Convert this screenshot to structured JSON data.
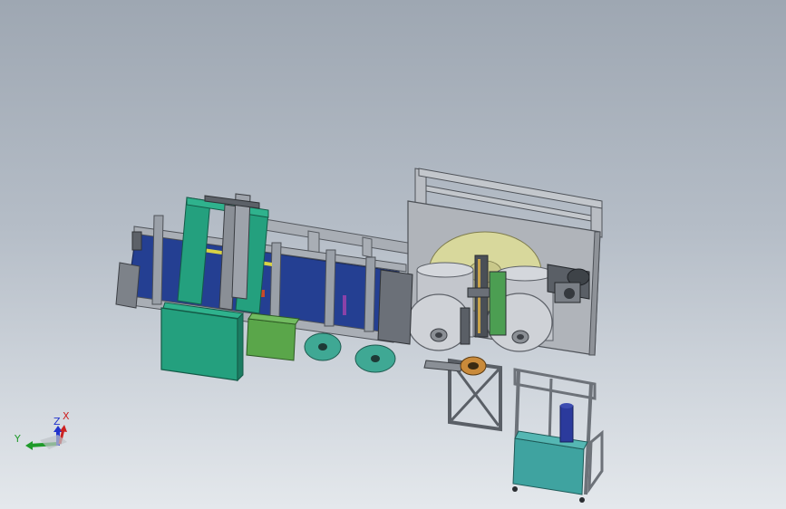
{
  "scene": {
    "description_kind": "cad-assembly-viewport",
    "background_top": "#9ea7b2",
    "background_bottom": "#e4e8ec"
  },
  "colors": {
    "frame_gray": "#9ea3ab",
    "frame_dark": "#5a5f66",
    "teal_panel": "#24a07e",
    "teal_dark": "#1b7c62",
    "conveyor_blue": "#1f3a8c",
    "roll_gray": "#c9ccd1",
    "yellow_disc": "#d9d89a",
    "green_box": "#5aa64a",
    "cart_teal": "#3fa3a0",
    "purple_cylinder": "#2b3a9c"
  },
  "triad": {
    "x_label": "X",
    "y_label": "Y",
    "z_label": "Z",
    "x_color": "#cc2222",
    "y_color": "#1f9a2a",
    "z_color": "#2233cc"
  }
}
